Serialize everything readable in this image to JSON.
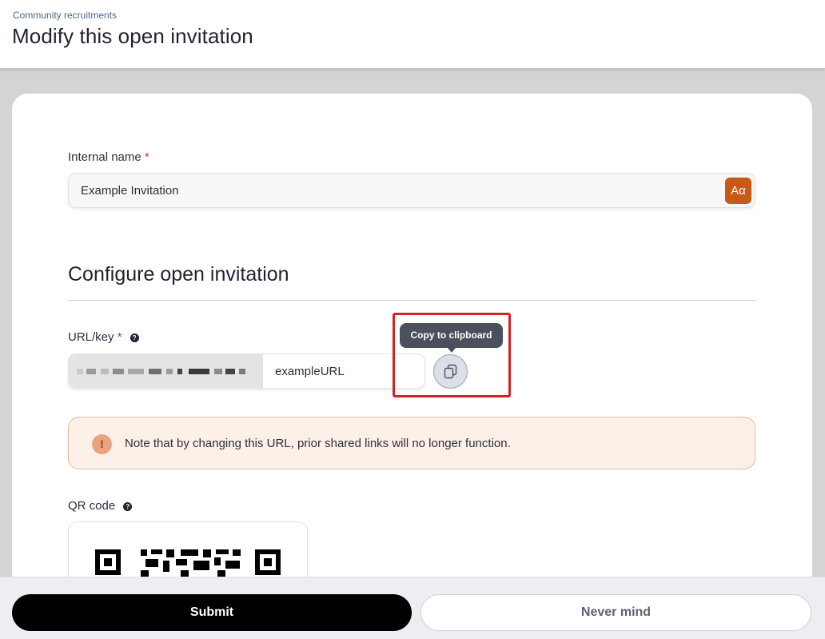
{
  "header": {
    "breadcrumb": "Community recruitments",
    "title": "Modify this open invitation"
  },
  "form": {
    "internal_name": {
      "label": "Internal name",
      "required_mark": "*",
      "value": "Example Invitation",
      "format_button_label": "Aα"
    },
    "section_title": "Configure open invitation",
    "url_key": {
      "label": "URL/key",
      "required_mark": "*",
      "help_icon_text": "?",
      "value": "exampleURL",
      "copy_tooltip": "Copy to clipboard"
    },
    "notice": {
      "icon_text": "!",
      "text": "Note that by changing this URL, prior shared links will no longer function."
    },
    "qr_code": {
      "label": "QR code",
      "help_icon_text": "?"
    }
  },
  "footer": {
    "submit_label": "Submit",
    "cancel_label": "Never mind"
  },
  "colors": {
    "accent_orange": "#c75a17",
    "highlight_red": "#d92020",
    "notice_bg": "#fdf0e8"
  }
}
